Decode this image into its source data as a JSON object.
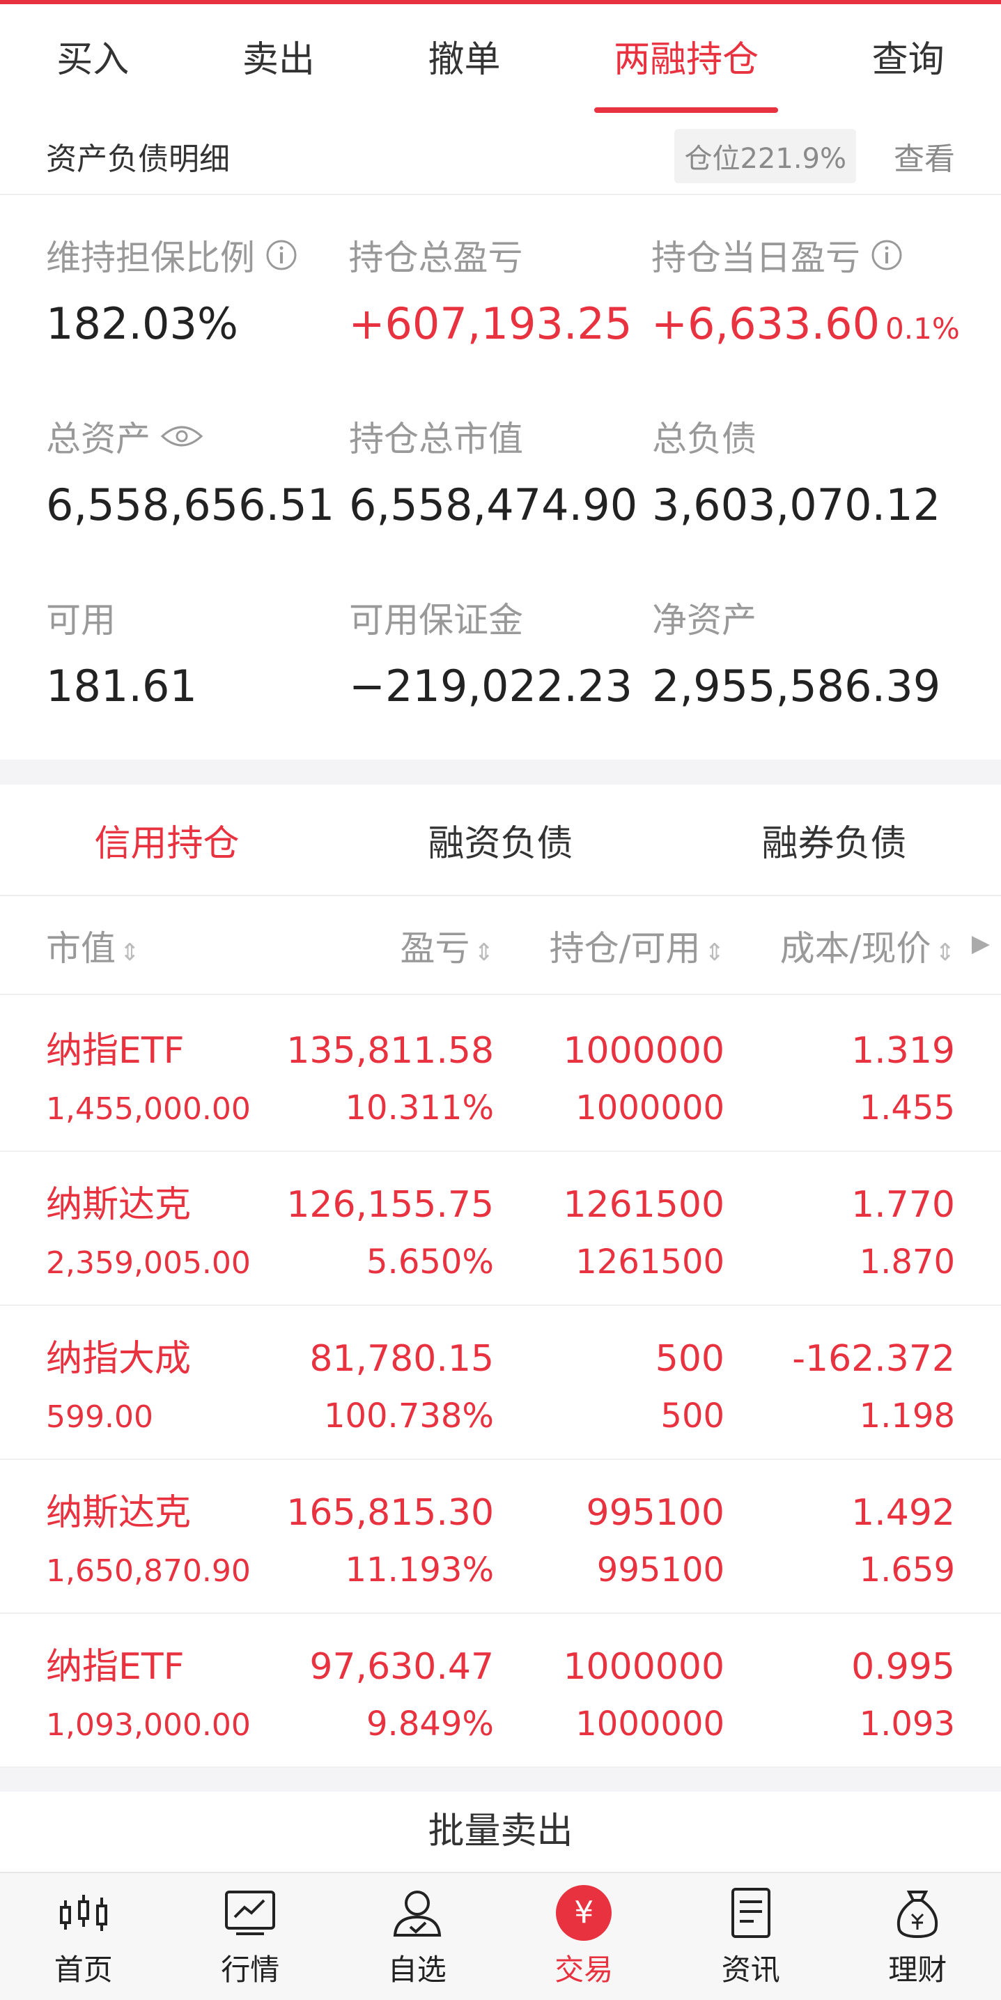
{
  "tabs": [
    "买入",
    "卖出",
    "撤单",
    "两融持仓",
    "查询"
  ],
  "active_tab": 3,
  "subheader": {
    "title": "资产负债明细",
    "position_ratio": "仓位221.9%",
    "view_label": "查看"
  },
  "summary": [
    [
      {
        "label": "维持担保比例",
        "value": "182.03%"
      },
      {
        "label": "持仓总盈亏",
        "value": "+607,193.25"
      },
      {
        "label": "持仓当日盈亏",
        "value": "+6,633.60",
        "pct": "0.1%"
      }
    ],
    [
      {
        "label": "总资产",
        "value": "6,558,656.51"
      },
      {
        "label": "持仓总市值",
        "value": "6,558,474.90"
      },
      {
        "label": "总负债",
        "value": "3,603,070.12"
      }
    ],
    [
      {
        "label": "可用",
        "value": "181.61"
      },
      {
        "label": "可用保证金",
        "value": "−219,022.23"
      },
      {
        "label": "净资产",
        "value": "2,955,586.39"
      }
    ]
  ],
  "section_tabs": [
    "信用持仓",
    "融资负债",
    "融券负债"
  ],
  "columns": [
    "市值",
    "盈亏",
    "持仓/可用",
    "成本/现价"
  ],
  "holdings": [
    {
      "name": "纳指ETF",
      "market_value": "1,455,000.00",
      "pnl": "135,811.58",
      "pnl_pct": "10.311%",
      "position": "1000000",
      "available": "1000000",
      "cost": "1.319",
      "price": "1.455"
    },
    {
      "name": "纳斯达克",
      "market_value": "2,359,005.00",
      "pnl": "126,155.75",
      "pnl_pct": "5.650%",
      "position": "1261500",
      "available": "1261500",
      "cost": "1.770",
      "price": "1.870"
    },
    {
      "name": "纳指大成",
      "market_value": "599.00",
      "pnl": "81,780.15",
      "pnl_pct": "100.738%",
      "position": "500",
      "available": "500",
      "cost": "-162.372",
      "price": "1.198"
    },
    {
      "name": "纳斯达克",
      "market_value": "1,650,870.90",
      "pnl": "165,815.30",
      "pnl_pct": "11.193%",
      "position": "995100",
      "available": "995100",
      "cost": "1.492",
      "price": "1.659"
    },
    {
      "name": "纳指ETF",
      "market_value": "1,093,000.00",
      "pnl": "97,630.47",
      "pnl_pct": "9.849%",
      "position": "1000000",
      "available": "1000000",
      "cost": "0.995",
      "price": "1.093"
    }
  ],
  "batch_sell": "批量卖出",
  "nav": [
    {
      "label": "首页",
      "icon": "candlestick-icon"
    },
    {
      "label": "行情",
      "icon": "chart-line-icon"
    },
    {
      "label": "自选",
      "icon": "user-check-icon"
    },
    {
      "label": "交易",
      "icon": "yen-icon",
      "glyph": "¥"
    },
    {
      "label": "资讯",
      "icon": "document-icon"
    },
    {
      "label": "理财",
      "icon": "money-bag-icon"
    }
  ],
  "colors": {
    "accent": "#e8323f",
    "muted": "#999999"
  }
}
